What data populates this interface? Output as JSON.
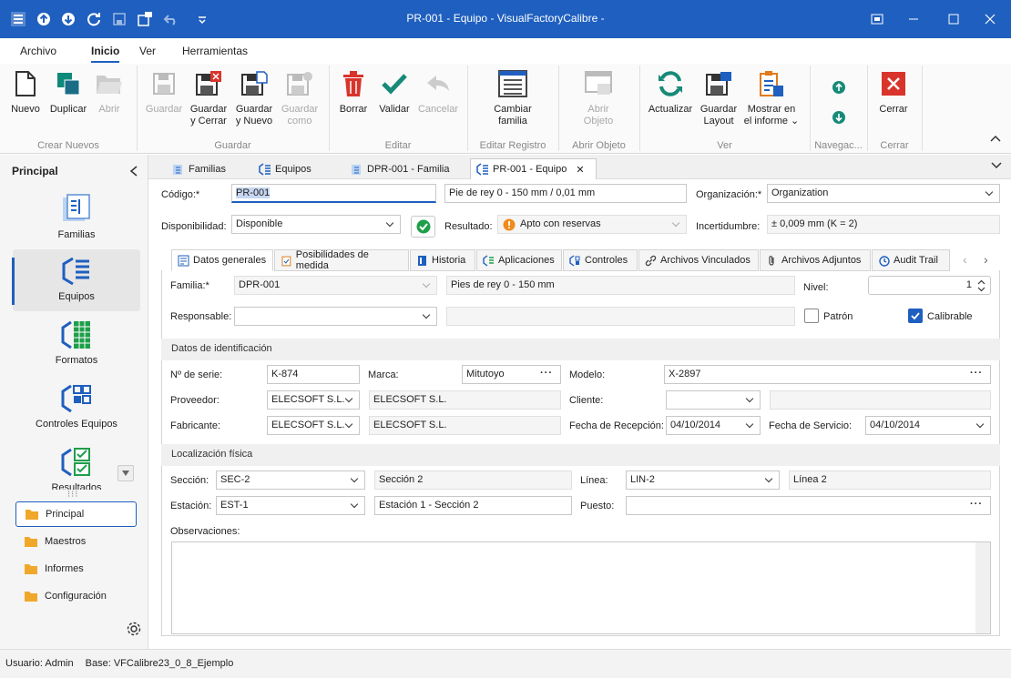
{
  "window": {
    "title": "PR-001 - Equipo - VisualFactoryCalibre -"
  },
  "menu": {
    "archivo": "Archivo",
    "inicio": "Inicio",
    "ver": "Ver",
    "herramientas": "Herramientas"
  },
  "ribbon": {
    "nuevo": "Nuevo",
    "duplicar": "Duplicar",
    "abrir": "Abrir",
    "guardar": "Guardar",
    "guardar_cerrar_1": "Guardar",
    "guardar_cerrar_2": "y Cerrar",
    "guardar_nuevo_1": "Guardar",
    "guardar_nuevo_2": "y Nuevo",
    "guardar_como_1": "Guardar",
    "guardar_como_2": "como",
    "borrar": "Borrar",
    "validar": "Validar",
    "cancelar": "Cancelar",
    "cambiar_familia_1": "Cambiar",
    "cambiar_familia_2": "familia",
    "abrir_objeto_1": "Abrir",
    "abrir_objeto_2": "Objeto",
    "actualizar": "Actualizar",
    "guardar_layout_1": "Guardar",
    "guardar_layout_2": "Layout",
    "mostrar_informe_1": "Mostrar en",
    "mostrar_informe_2": "el informe",
    "cerrar": "Cerrar",
    "groups": {
      "crear": "Crear Nuevos",
      "guardar": "Guardar",
      "editar": "Editar",
      "editar_registro": "Editar Registro",
      "abrir_objeto": "Abrir Objeto",
      "ver": "Ver",
      "navegacion": "Navegac...",
      "cerrar": "Cerrar"
    }
  },
  "sidebar": {
    "title": "Principal",
    "items": [
      "Familias",
      "Equipos",
      "Formatos",
      "Controles Equipos",
      "Resultados"
    ],
    "nav": [
      "Principal",
      "Maestros",
      "Informes",
      "Configuración"
    ]
  },
  "doctabs": [
    "Familias",
    "Equipos",
    "DPR-001 - Familia",
    "PR-001 - Equipo"
  ],
  "header": {
    "codigo_label": "Código:*",
    "codigo": "PR-001",
    "descripcion": "Pie de rey 0 - 150 mm / 0,01 mm",
    "organizacion_label": "Organización:*",
    "organizacion": "Organization",
    "disponibilidad_label": "Disponibilidad:",
    "disponibilidad": "Disponible",
    "resultado_label": "Resultado:",
    "resultado": "Apto con reservas",
    "incertidumbre_label": "Incertidumbre:",
    "incertidumbre": "± 0,009 mm (K = 2)"
  },
  "tabs": [
    "Datos generales",
    "Posibilidades de medida",
    "Historia",
    "Aplicaciones",
    "Controles",
    "Archivos Vinculados",
    "Archivos Adjuntos",
    "Audit Trail"
  ],
  "general": {
    "familia_label": "Familia:*",
    "familia": "DPR-001",
    "familia_desc": "Pies de rey 0 - 150 mm",
    "nivel_label": "Nivel:",
    "nivel": "1",
    "responsable_label": "Responsable:",
    "patron_label": "Patrón",
    "calibrable_label": "Calibrable"
  },
  "identificacion": {
    "title": "Datos de identificación",
    "serie_label": "Nº de serie:",
    "serie": "K-874",
    "marca_label": "Marca:",
    "marca": "Mitutoyo",
    "modelo_label": "Modelo:",
    "modelo": "X-2897",
    "proveedor_label": "Proveedor:",
    "proveedor": "ELECSOFT S.L.",
    "proveedor_desc": "ELECSOFT S.L.",
    "cliente_label": "Cliente:",
    "fabricante_label": "Fabricante:",
    "fabricante": "ELECSOFT S.L.",
    "fabricante_desc": "ELECSOFT S.L.",
    "recepcion_label": "Fecha de Recepción:",
    "recepcion": "04/10/2014",
    "servicio_label": "Fecha de Servicio:",
    "servicio": "04/10/2014"
  },
  "localizacion": {
    "title": "Localización física",
    "seccion_label": "Sección:",
    "seccion": "SEC-2",
    "seccion_desc": "Sección 2",
    "linea_label": "Línea:",
    "linea": "LIN-2",
    "linea_desc": "Línea 2",
    "estacion_label": "Estación:",
    "estacion": "EST-1",
    "estacion_desc": "Estación 1 - Sección 2",
    "puesto_label": "Puesto:",
    "observaciones_label": "Observaciones:"
  },
  "status": {
    "usuario": "Usuario: Admin",
    "base": "Base: VFCalibre23_0_8_Ejemplo"
  }
}
